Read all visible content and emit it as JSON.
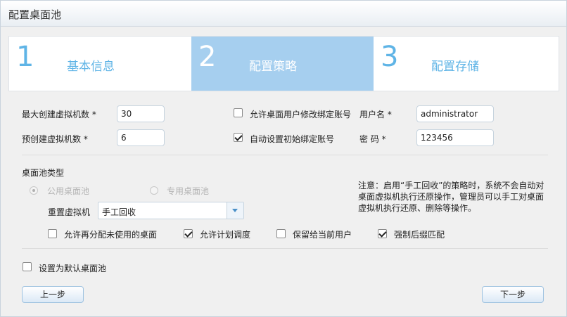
{
  "window": {
    "title": "配置桌面池"
  },
  "steps": [
    {
      "num": "1",
      "label": "基本信息"
    },
    {
      "num": "2",
      "label": "配置策略"
    },
    {
      "num": "3",
      "label": "配置存储"
    }
  ],
  "form": {
    "max_vm_label": "最大创建虚拟机数",
    "max_vm_value": "30",
    "precreate_label": "预创建虚拟机数",
    "precreate_value": "6",
    "required_mark": "*",
    "allow_modify_label": "允许桌面用户修改绑定账号",
    "allow_modify_checked": false,
    "auto_set_label": "自动设置初始绑定账号",
    "auto_set_checked": true,
    "username_label": "用户名",
    "username_value": "administrator",
    "password_label": "密 码",
    "password_value": "123456"
  },
  "pool_type": {
    "section_label": "桌面池类型",
    "option_public": "公用桌面池",
    "option_private": "专用桌面池",
    "selected": "公用桌面池",
    "reset_label": "重置虚拟机",
    "reset_value": "手工回收",
    "options": [
      {
        "label": "允许再分配未使用的桌面",
        "checked": false
      },
      {
        "label": "允许计划调度",
        "checked": true
      },
      {
        "label": "保留给当前用户",
        "checked": false
      },
      {
        "label": "强制后缀匹配",
        "checked": true
      }
    ],
    "note": "注意：启用“手工回收”的策略时，系统不会自动对桌面虚拟机执行还原操作，管理员可以手工对桌面虚拟机执行还原、删除等操作。"
  },
  "default_pool": {
    "label": "设置为默认桌面池",
    "checked": false
  },
  "buttons": {
    "prev": "上一步",
    "next": "下一步"
  }
}
